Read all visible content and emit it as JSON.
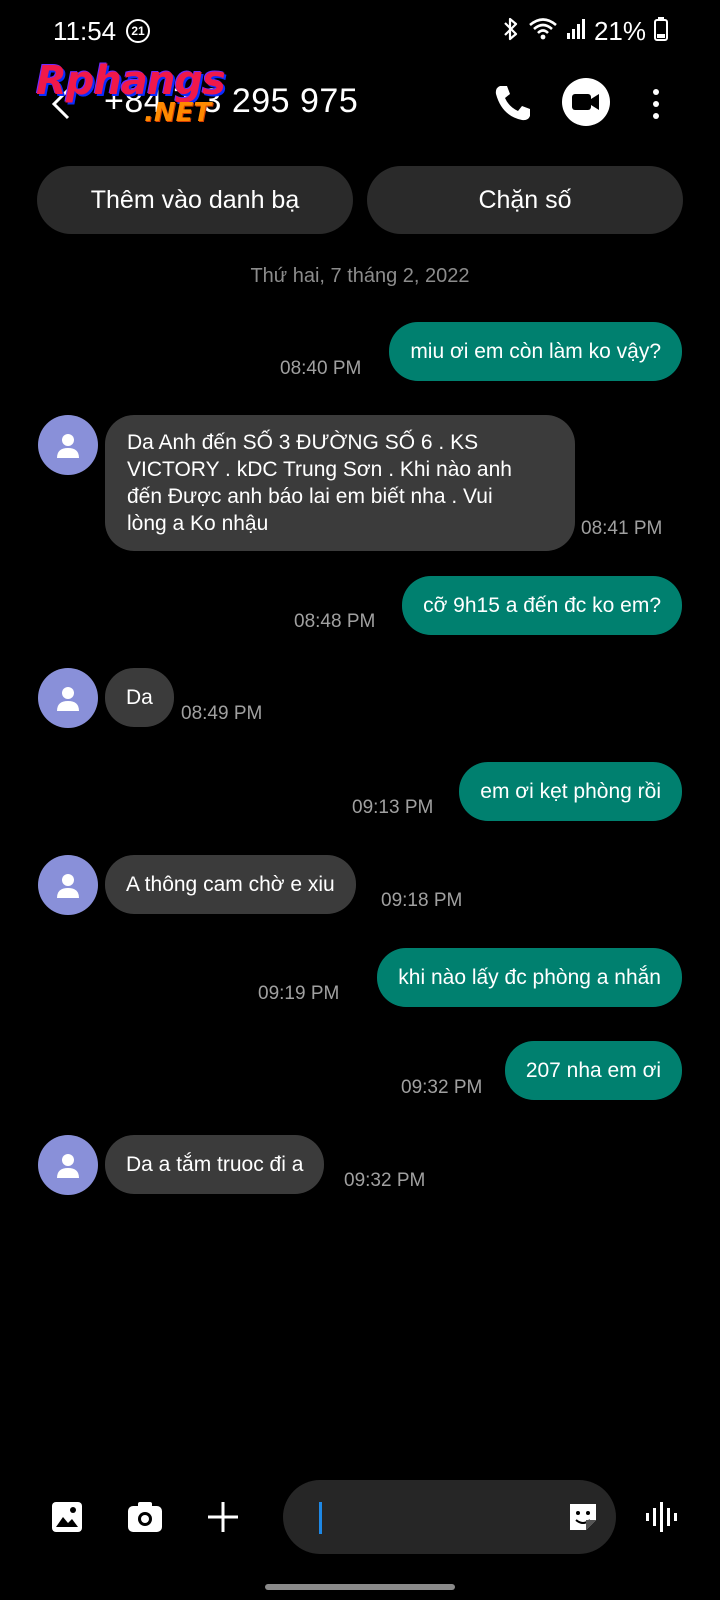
{
  "status_bar": {
    "time": "11:54",
    "badge": "21",
    "battery": "21%"
  },
  "header": {
    "contact": "+84 7  3 295 975",
    "watermark_main": "Rphangs",
    "watermark_sub": ".NET"
  },
  "actions": {
    "add_contact": "Thêm vào danh bạ",
    "block": "Chặn số"
  },
  "date_separator": "Thứ hai, 7 tháng 2, 2022",
  "messages": [
    {
      "dir": "out",
      "text": "miu ơi em còn làm ko vậy?",
      "time": "08:40 PM"
    },
    {
      "dir": "in",
      "lines": [
        "Da Anh đến SỐ 3 ĐƯỜNG SỐ 6 . KS",
        "VICTORY . kDC Trung Sơn . Khi nào anh",
        "đến Được anh báo lai em biết  nha . Vui",
        "lòng a Ko nhậu"
      ],
      "time": "08:41 PM"
    },
    {
      "dir": "out",
      "text": "cỡ 9h15 a đến đc ko em?",
      "time": "08:48 PM"
    },
    {
      "dir": "in",
      "text": "Da",
      "time": "08:49 PM"
    },
    {
      "dir": "out",
      "text": "em ơi kẹt phòng rồi",
      "time": "09:13 PM"
    },
    {
      "dir": "in",
      "text": "A thông cam chờ e xiu",
      "time": "09:18 PM"
    },
    {
      "dir": "out",
      "text": "khi nào lấy đc phòng a nhắn",
      "time": "09:19 PM"
    },
    {
      "dir": "out",
      "text": "207 nha em ơi",
      "time": "09:32 PM"
    },
    {
      "dir": "in",
      "text": "Da a tắm truoc đi a",
      "time": "09:32 PM"
    }
  ],
  "composer": {
    "placeholder": ""
  },
  "colors": {
    "outgoing_bubble": "#00806f",
    "incoming_bubble": "#3b3b3b",
    "avatar": "#8990d9",
    "action_button": "#2a2a2a"
  },
  "icons": [
    "wifi-icon",
    "bluetooth-icon",
    "signal-icon",
    "battery-icon",
    "back-icon",
    "phone-icon",
    "video-call-icon",
    "more-icon",
    "person-icon",
    "gallery-icon",
    "camera-icon",
    "add-icon",
    "sticker-icon",
    "voice-icon"
  ]
}
